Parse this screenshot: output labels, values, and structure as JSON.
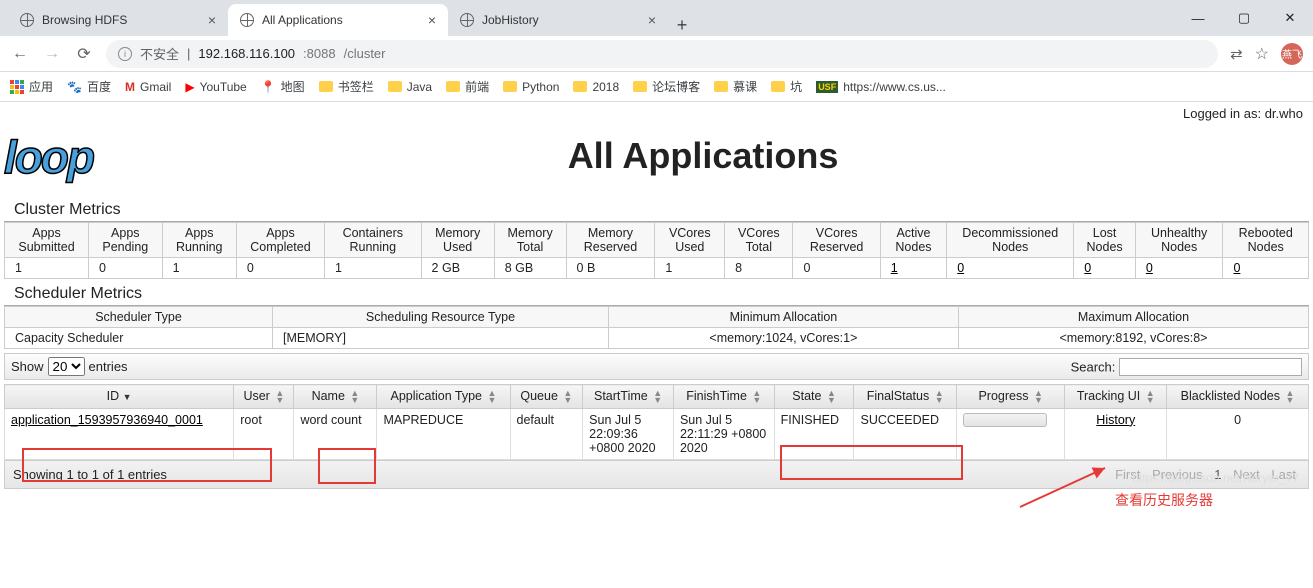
{
  "browser": {
    "tabs": [
      {
        "title": "Browsing HDFS",
        "active": false
      },
      {
        "title": "All Applications",
        "active": true
      },
      {
        "title": "JobHistory",
        "active": false
      }
    ],
    "nav": {
      "back": "←",
      "forward": "→",
      "reload": "⟳"
    },
    "url": {
      "insecure": "不安全",
      "host": "192.168.116.100",
      "port": ":8088",
      "path": "/cluster"
    },
    "right": {
      "translate": "⇄",
      "star": "☆",
      "avatar": "燕飞"
    },
    "bookmarks": {
      "apps": "应用",
      "items": [
        {
          "icon": "paw",
          "label": "百度",
          "color": "#2b6cd4"
        },
        {
          "icon": "M",
          "label": "Gmail",
          "color": "#d93025"
        },
        {
          "icon": "▶",
          "label": "YouTube",
          "color": "#ff0000"
        },
        {
          "icon": "pin",
          "label": "地图",
          "color": "#34a853"
        }
      ],
      "folders": [
        "书签栏",
        "Java",
        "前端",
        "Python",
        "2018",
        "论坛博客",
        "慕课",
        "坑"
      ],
      "last": {
        "badge": "USF",
        "text": "https://www.cs.us..."
      }
    }
  },
  "page": {
    "login": "Logged in as: dr.who",
    "logo": "loop",
    "title": "All Applications",
    "clusterHeader": "Cluster Metrics",
    "cluster": {
      "headers": [
        "Apps Submitted",
        "Apps Pending",
        "Apps Running",
        "Apps Completed",
        "Containers Running",
        "Memory Used",
        "Memory Total",
        "Memory Reserved",
        "VCores Used",
        "VCores Total",
        "VCores Reserved",
        "Active Nodes",
        "Decommissioned Nodes",
        "Lost Nodes",
        "Unhealthy Nodes",
        "Rebooted Nodes"
      ],
      "values": [
        "1",
        "0",
        "1",
        "0",
        "1",
        "2 GB",
        "8 GB",
        "0 B",
        "1",
        "8",
        "0",
        "1",
        "0",
        "0",
        "0",
        "0"
      ],
      "linkCols": [
        11,
        12,
        13,
        14,
        15
      ]
    },
    "schedHeader": "Scheduler Metrics",
    "sched": {
      "headers": [
        "Scheduler Type",
        "Scheduling Resource Type",
        "Minimum Allocation",
        "Maximum Allocation"
      ],
      "values": [
        "Capacity Scheduler",
        "[MEMORY]",
        "<memory:1024, vCores:1>",
        "<memory:8192, vCores:8>"
      ]
    },
    "dt": {
      "showPre": "Show",
      "showPost": "entries",
      "showVal": "20",
      "searchLabel": "Search:"
    },
    "apps": {
      "headers": [
        "ID",
        "User",
        "Name",
        "Application Type",
        "Queue",
        "StartTime",
        "FinishTime",
        "State",
        "FinalStatus",
        "Progress",
        "Tracking UI",
        "Blacklisted Nodes"
      ],
      "row": {
        "id": "application_1593957936940_0001",
        "user": "root",
        "name": "word count",
        "type": "MAPREDUCE",
        "queue": "default",
        "start": "Sun Jul 5 22:09:36 +0800 2020",
        "finish": "Sun Jul 5 22:11:29 +0800 2020",
        "state": "FINISHED",
        "final": "SUCCEEDED",
        "tracking": "History",
        "blacklisted": "0"
      }
    },
    "info": "Showing 1 to 1 of 1 entries",
    "paginate": {
      "first": "First",
      "prev": "Previous",
      "page": "1",
      "next": "Next",
      "last": "Last"
    },
    "annotation": "查看历史服务器",
    "watermark": "https://blog.csdn.net/Noryer_77"
  }
}
